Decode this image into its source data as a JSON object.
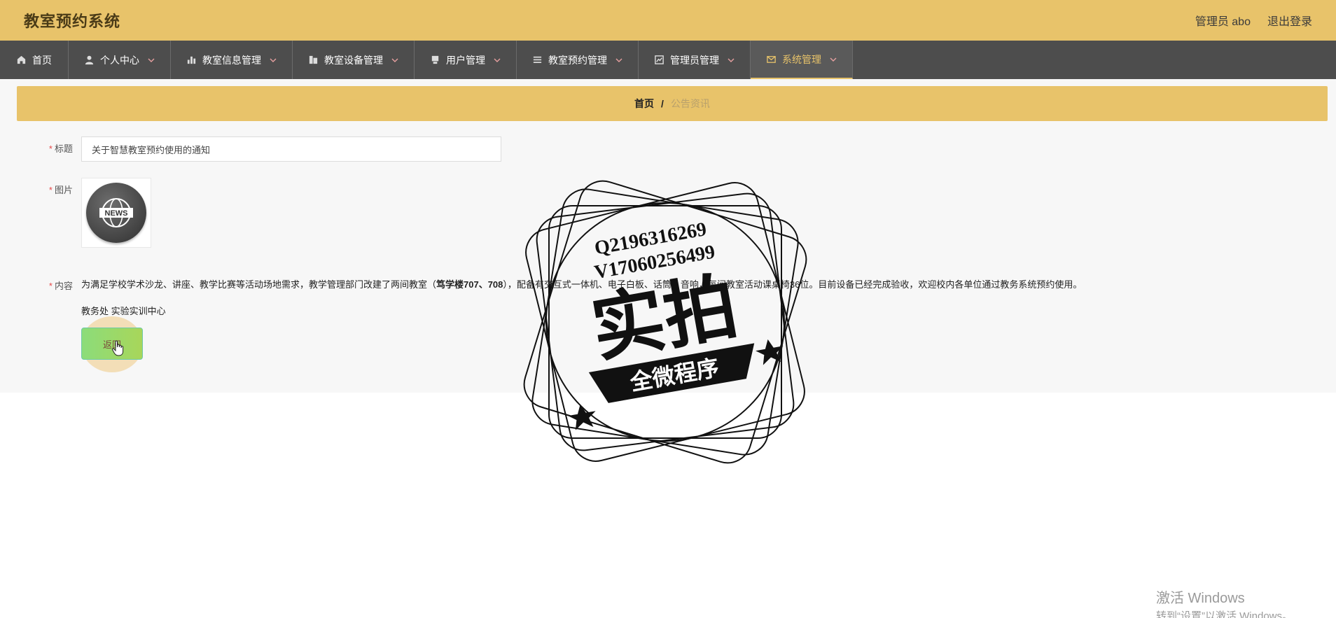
{
  "header": {
    "app_title": "教室预约系统",
    "user_label": "管理员 abo",
    "logout_label": "退出登录"
  },
  "nav": {
    "items": [
      {
        "label": "首页",
        "icon": "home-icon",
        "has_dropdown": false,
        "active": false
      },
      {
        "label": "个人中心",
        "icon": "user-icon",
        "has_dropdown": true,
        "active": false
      },
      {
        "label": "教室信息管理",
        "icon": "bar-chart-icon",
        "has_dropdown": true,
        "active": false
      },
      {
        "label": "教室设备管理",
        "icon": "building-icon",
        "has_dropdown": true,
        "active": false
      },
      {
        "label": "用户管理",
        "icon": "monitor-icon",
        "has_dropdown": true,
        "active": false
      },
      {
        "label": "教室预约管理",
        "icon": "list-icon",
        "has_dropdown": true,
        "active": false
      },
      {
        "label": "管理员管理",
        "icon": "line-chart-icon",
        "has_dropdown": true,
        "active": false
      },
      {
        "label": "系统管理",
        "icon": "mail-icon",
        "has_dropdown": true,
        "active": true
      }
    ]
  },
  "breadcrumb": {
    "home": "首页",
    "separator": "/",
    "current": "公告资讯"
  },
  "form": {
    "title_label": "标题",
    "title_value": "关于智慧教室预约使用的通知",
    "picture_label": "图片",
    "picture_text": "NEWS",
    "content_label": "内容",
    "content_part1": "为满足学校学术沙龙、讲座、教学比赛等活动场地需求，教学管理部门改建了两间教室（",
    "content_bold": "笃学楼707、708",
    "content_part2": "），配备有交互式一体机、电子白板、话筒、音响，每间教室活动课桌椅36位。目前设备已经完成验收，欢迎校内各单位通过教务系统预约使用。",
    "content_signature": "教务处 实验实训中心",
    "back_label": "返回"
  },
  "stamp": {
    "line1": "Q2196316269",
    "line2": "V17060256499",
    "big": "实拍",
    "banner": "全微程序"
  },
  "windows_watermark": {
    "title": "激活 Windows",
    "subtitle": "转到“设置”以激活 Windows。"
  },
  "colors": {
    "header_bg": "#e8c36a",
    "nav_bg": "#4d4d4d",
    "accent": "#e8c36a",
    "required": "#e64a4a"
  }
}
